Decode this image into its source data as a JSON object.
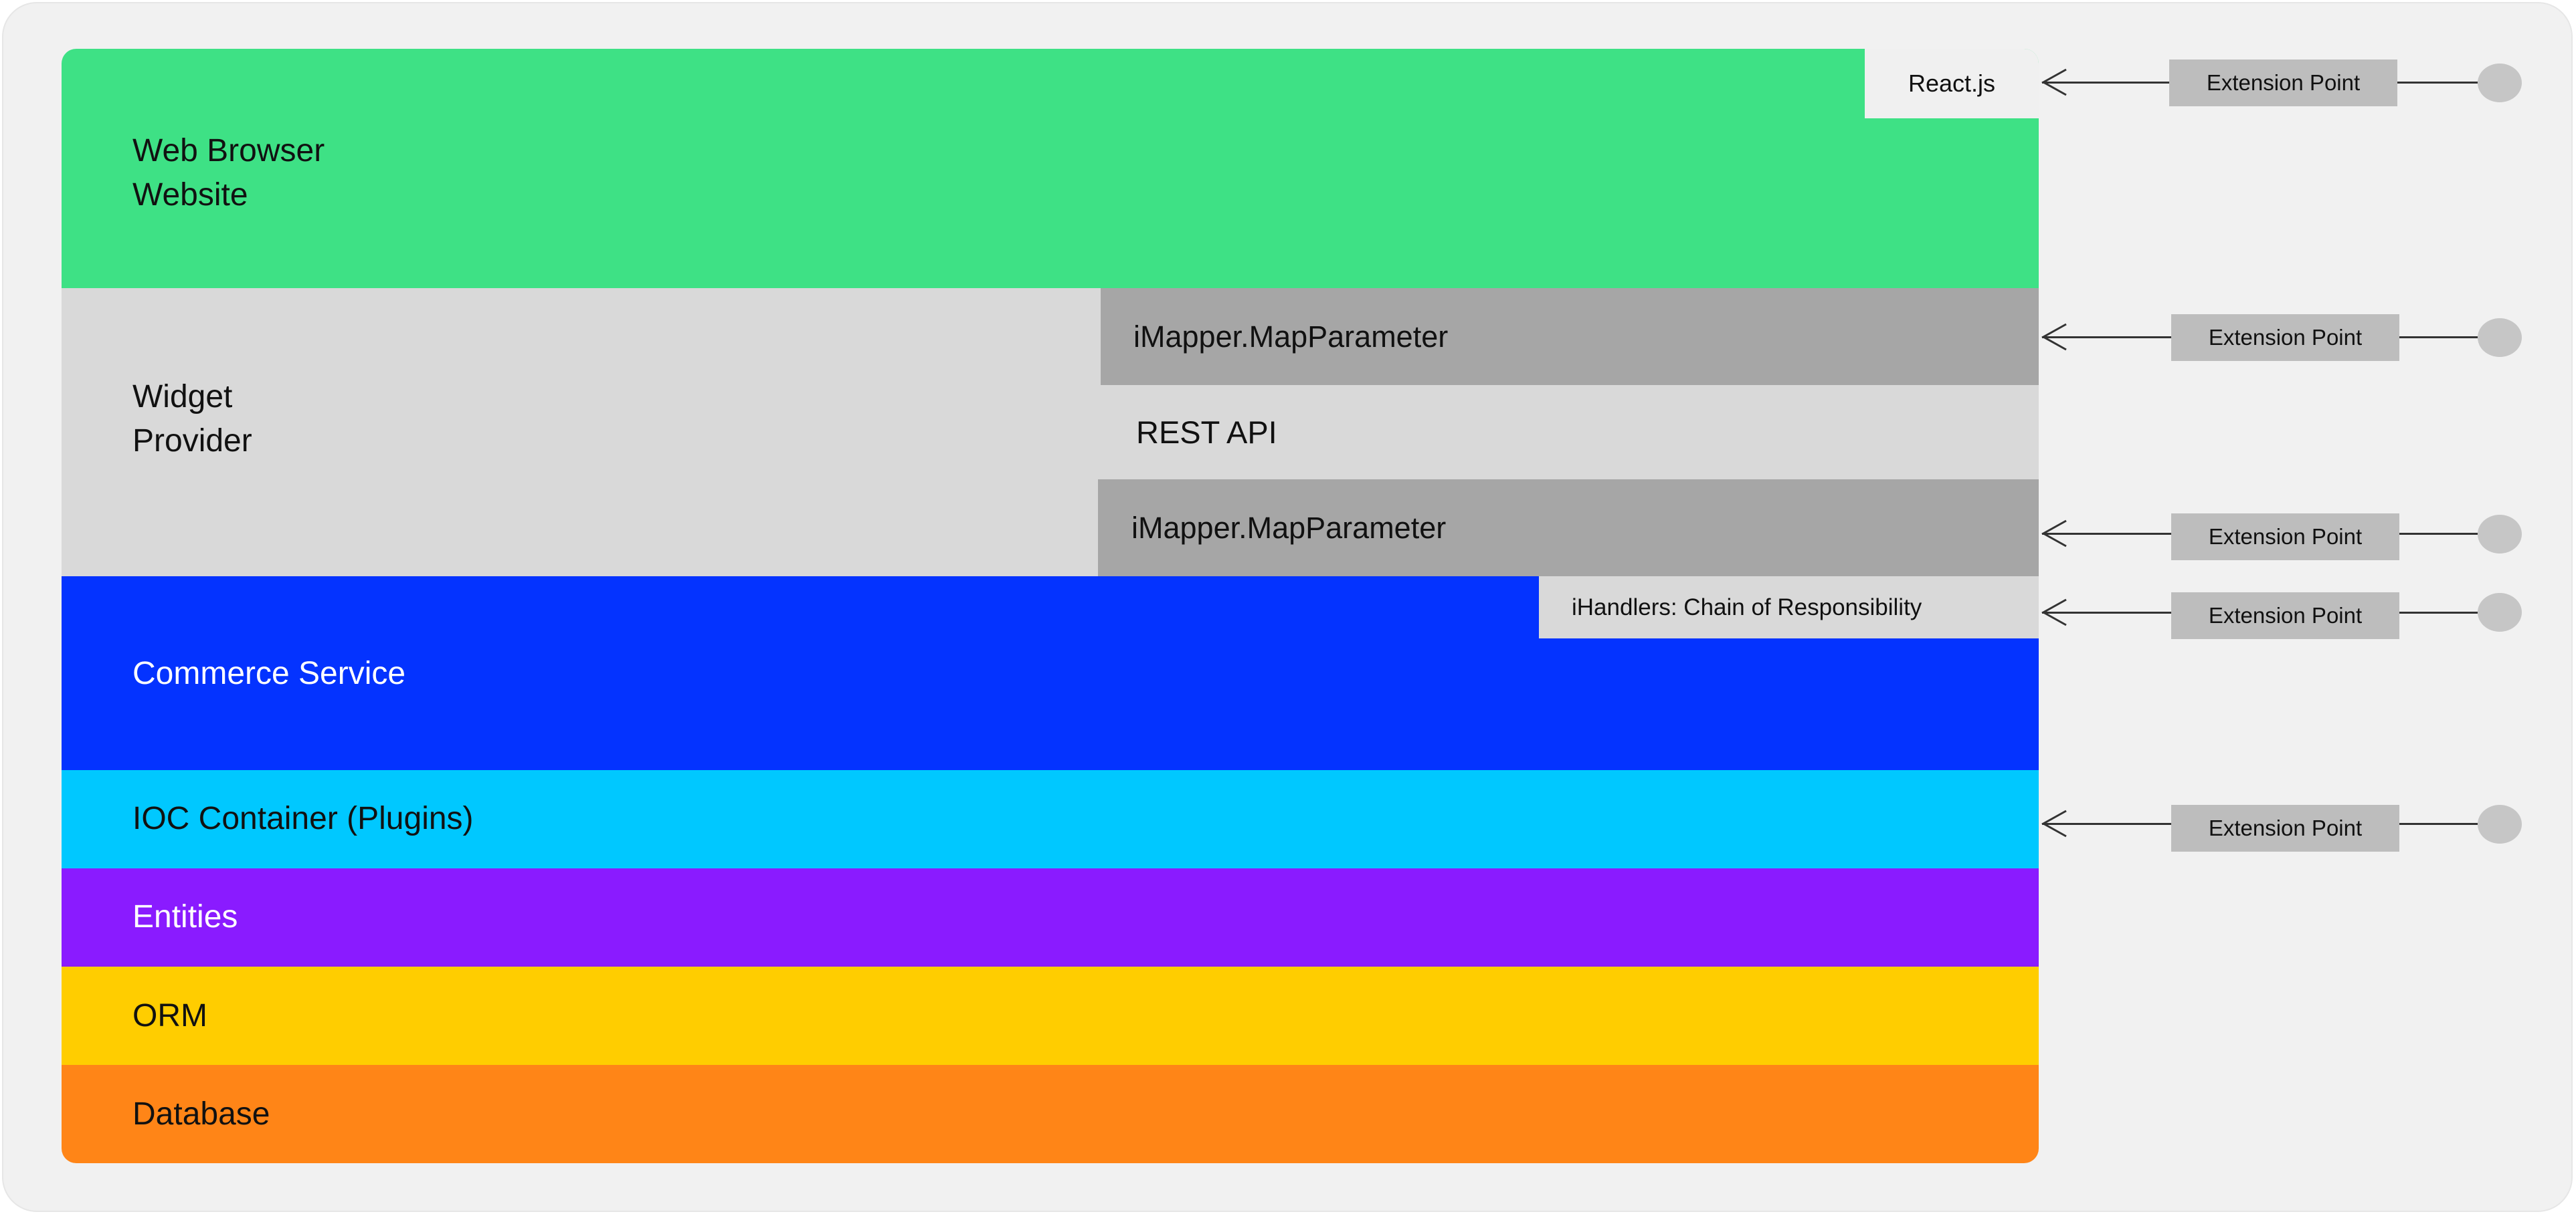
{
  "layers": {
    "web_browser": {
      "label": "Web Browser\nWebsite",
      "color": "#3ee185"
    },
    "widget_provider": {
      "label": "Widget\nProvider",
      "color": "#d9d9d9"
    },
    "commerce_service": {
      "label": "Commerce Service",
      "color": "#0433ff"
    },
    "ioc_container": {
      "label": "IOC Container (Plugins)",
      "color": "#00c8ff"
    },
    "entities": {
      "label": "Entities",
      "color": "#8a1bff"
    },
    "orm": {
      "label": "ORM",
      "color": "#ffcd00"
    },
    "database": {
      "label": "Database",
      "color": "#ff8517"
    }
  },
  "components": {
    "react": "React.js",
    "mapper_top": "iMapper.MapParameter",
    "rest_api": "REST API",
    "mapper_bottom": "iMapper.MapParameter",
    "handlers": "iHandlers: Chain of Responsibility"
  },
  "extension_points": [
    "Extension Point",
    "Extension Point",
    "Extension Point",
    "Extension Point",
    "Extension Point"
  ],
  "colors": {
    "frame": "#f1f1f1",
    "mapper_box": "#a6a6a6",
    "light_box": "#f0f0f0",
    "handlers_box": "#d9d9d9",
    "extension_pill": "#bdbdbd",
    "connector_dot": "#c6c6c6"
  }
}
